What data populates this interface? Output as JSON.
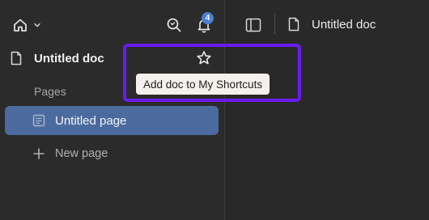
{
  "topbar": {
    "home_icon": "home-icon",
    "dropdown_icon": "chevron-down-icon",
    "search_icon": "search-icon",
    "notifications_icon": "bell-icon",
    "notification_count": "4"
  },
  "doc": {
    "icon": "document-icon",
    "title": "Untitled doc",
    "favorite_icon": "star-icon"
  },
  "tooltip": {
    "text": "Add doc to My Shortcuts"
  },
  "sidebar": {
    "section_label": "Pages",
    "pages": [
      {
        "label": "Untitled page",
        "icon": "page-icon",
        "selected": true
      }
    ],
    "new_page_label": "New page",
    "new_page_icon": "plus-icon"
  },
  "main": {
    "toggle_icon": "sidebar-toggle-icon",
    "doc_icon": "document-icon",
    "doc_title": "Untitled doc"
  },
  "colors": {
    "background": "#2b2b2b",
    "selected_item": "#4b6b9e",
    "badge": "#4a7fd4",
    "highlight": "#6a1cf0",
    "tooltip_bg": "#f4f1ec"
  }
}
